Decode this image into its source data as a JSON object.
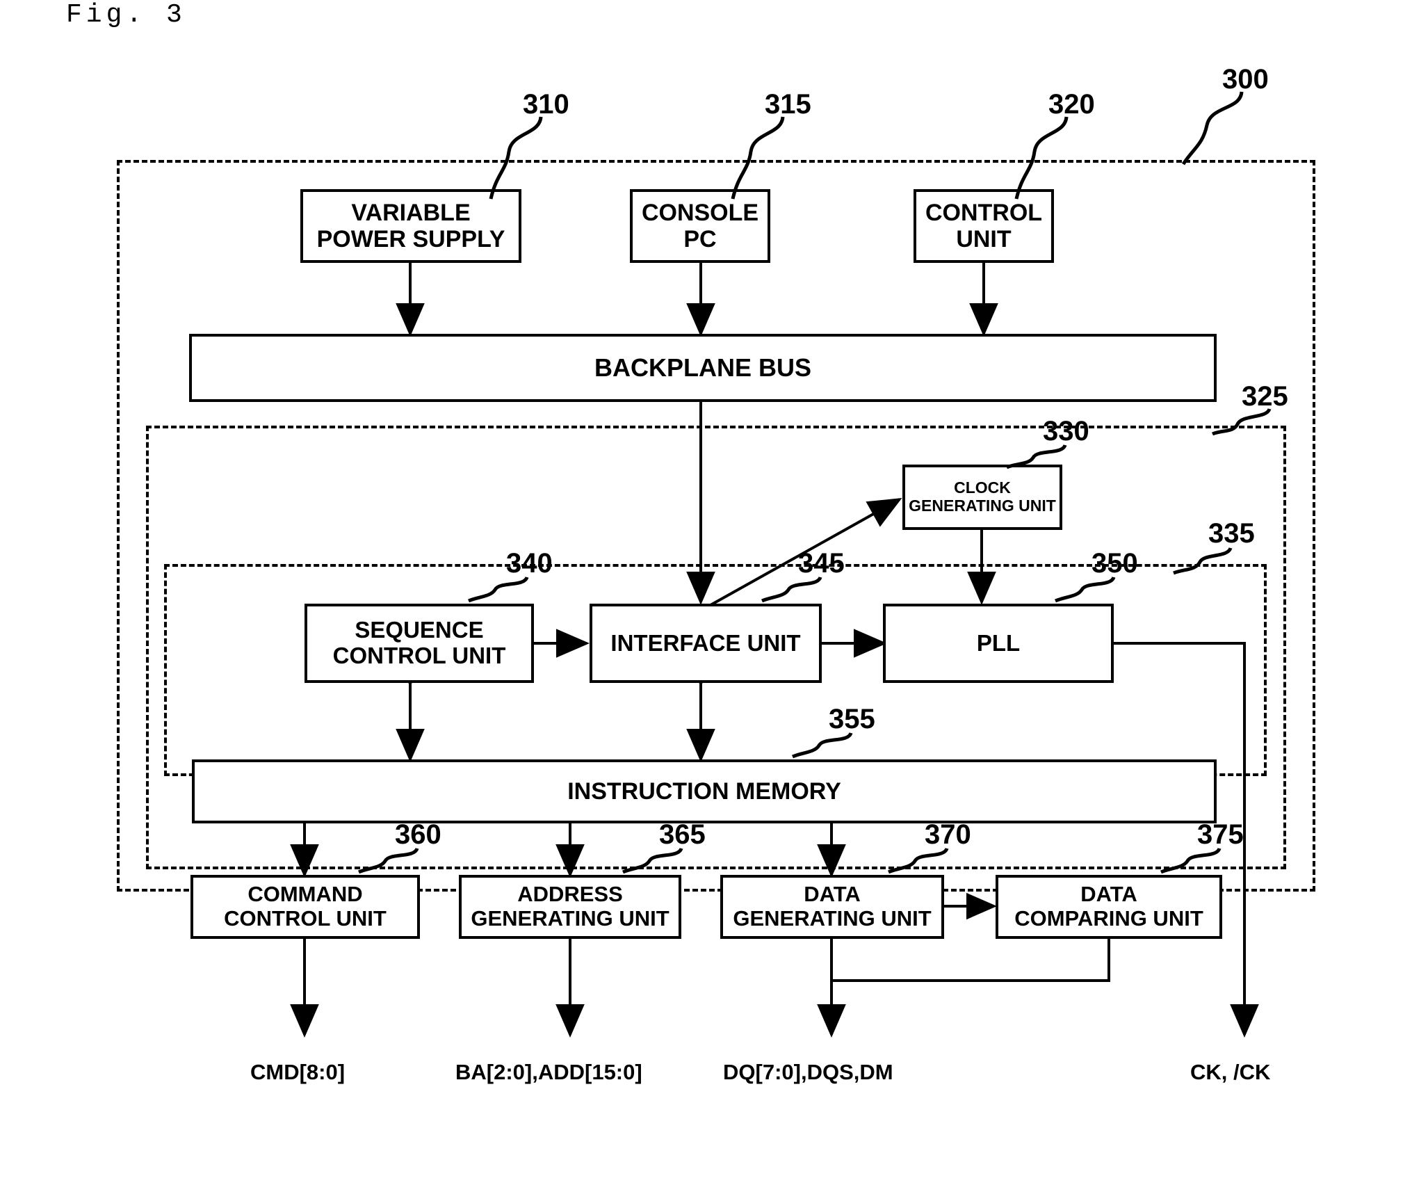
{
  "figure": {
    "title": "Fig. 3",
    "kind": "block-diagram"
  },
  "blocks": {
    "variable_power_supply": {
      "line1": "VARIABLE",
      "line2": "POWER SUPPLY",
      "ref": "310"
    },
    "console_pc": {
      "line1": "CONSOLE",
      "line2": "PC",
      "ref": "315"
    },
    "control_unit": {
      "line1": "CONTROL",
      "line2": "UNIT",
      "ref": "320"
    },
    "backplane_bus": {
      "line1": "BACKPLANE BUS"
    },
    "clock_generating_unit": {
      "line1": "CLOCK",
      "line2": "GENERATING UNIT",
      "ref": "330"
    },
    "sequence_control_unit": {
      "line1": "SEQUENCE",
      "line2": "CONTROL UNIT",
      "ref": "340"
    },
    "interface_unit": {
      "line1": "INTERFACE UNIT",
      "ref": "345"
    },
    "pll": {
      "line1": "PLL",
      "ref": "350"
    },
    "instruction_memory": {
      "line1": "INSTRUCTION MEMORY",
      "ref": "355"
    },
    "command_control_unit": {
      "line1": "COMMAND",
      "line2": "CONTROL UNIT",
      "ref": "360"
    },
    "address_generating_unit": {
      "line1": "ADDRESS",
      "line2": "GENERATING UNIT",
      "ref": "365"
    },
    "data_generating_unit": {
      "line1": "DATA",
      "line2": "GENERATING UNIT",
      "ref": "370"
    },
    "data_comparing_unit": {
      "line1": "DATA",
      "line2": "COMPARING UNIT",
      "ref": "375"
    }
  },
  "enclosures": {
    "outer_system": {
      "ref": "300"
    },
    "tester_unit": {
      "ref": "325"
    },
    "pattern_generator": {
      "ref": "335"
    }
  },
  "signals": {
    "cmd": "CMD[8:0]",
    "addr": "BA[2:0],ADD[15:0]",
    "data": "DQ[7:0],DQS,DM",
    "clock": "CK, /CK"
  },
  "colors": {
    "ink": "#000000",
    "paper": "#ffffff"
  }
}
